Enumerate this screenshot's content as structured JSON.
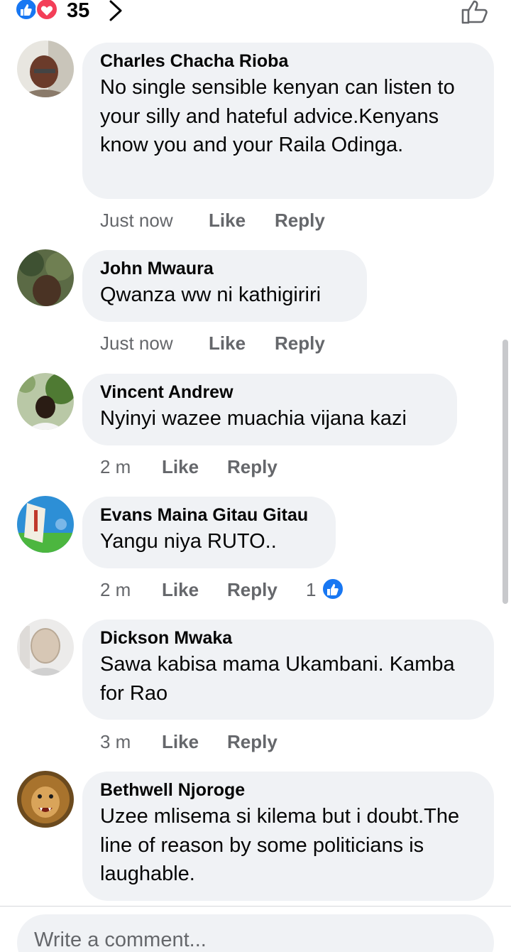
{
  "header": {
    "reaction_count": "35",
    "colors": {
      "like_blue": "#1877f2",
      "love_red": "#f33e58"
    },
    "icons": [
      "like-reaction-icon",
      "love-reaction-icon",
      "chevron-right-icon",
      "like-outline-icon"
    ]
  },
  "comments": [
    {
      "author": "Charles Chacha Rioba",
      "text": "No single sensible kenyan can listen to your silly and hateful advice.Kenyans know you and your Raila Odinga.",
      "time": "Just now",
      "like": "Like",
      "reply": "Reply"
    },
    {
      "author": "John Mwaura",
      "text": "Qwanza ww ni kathigiriri",
      "time": "Just now",
      "like": "Like",
      "reply": "Reply"
    },
    {
      "author": "Vincent Andrew",
      "text": "Nyinyi wazee muachia vijana kazi",
      "time": "2 m",
      "like": "Like",
      "reply": "Reply"
    },
    {
      "author": "Evans Maina Gitau Gitau",
      "text": "Yangu niya RUTO..",
      "time": "2 m",
      "like": "Like",
      "reply": "Reply",
      "reaction_count": "1"
    },
    {
      "author": "Dickson Mwaka",
      "text": "Sawa kabisa mama Ukambani. Kamba for Rao",
      "time": "3 m",
      "like": "Like",
      "reply": "Reply"
    },
    {
      "author": "Bethwell Njoroge",
      "text": "Uzee mlisema si kilema but i doubt.The line of reason by some politicians is laughable.",
      "time": "",
      "like": "",
      "reply": ""
    }
  ],
  "comment_input": {
    "placeholder": "Write a comment..."
  }
}
